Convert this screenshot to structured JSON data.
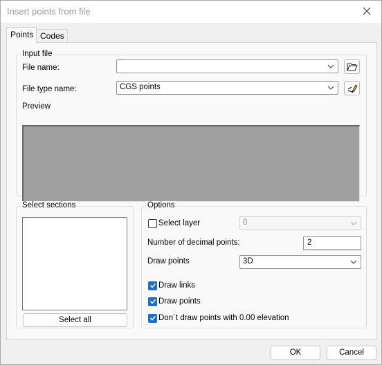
{
  "window": {
    "title": "Insert points from file"
  },
  "tabs": [
    {
      "label": "Points",
      "active": true
    },
    {
      "label": "Codes",
      "active": false
    }
  ],
  "input_file": {
    "group_label": "Input file",
    "file_name_label": "File name:",
    "file_name_value": "",
    "file_type_label": "File type name:",
    "file_type_value": "CGS points",
    "preview_label": "Preview"
  },
  "select_sections": {
    "group_label": "Select sections",
    "items": [],
    "select_all_label": "Select all"
  },
  "options": {
    "group_label": "Options",
    "select_layer_label": "Select layer",
    "select_layer_checked": false,
    "layer_value": "0",
    "decimal_points_label": "Number of decimal points:",
    "decimal_points_value": "2",
    "draw_points_label": "Draw points",
    "draw_points_value": "3D",
    "draw_links_label": "Draw links",
    "draw_links_checked": true,
    "draw_points_check_label": "Draw points",
    "draw_points_checked": true,
    "no_zero_elev_label": "Don´t draw points with 0.00 elevation",
    "no_zero_elev_checked": true
  },
  "footer": {
    "ok_label": "OK",
    "cancel_label": "Cancel"
  },
  "colors": {
    "accent": "#1f6fc4",
    "preview_bg": "#a0a0a0",
    "dialog_bg": "#f0f0f0"
  },
  "icons": [
    "close-icon",
    "chevron-down-icon",
    "folder-open-icon",
    "edit-format-icon",
    "checkmark-icon"
  ]
}
